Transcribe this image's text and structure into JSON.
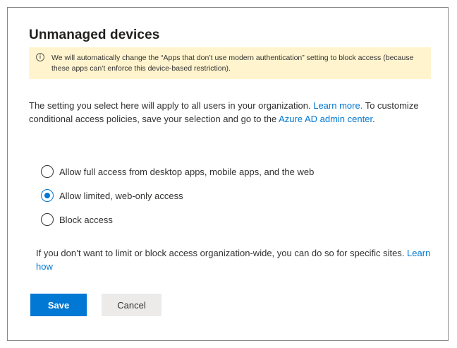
{
  "panel": {
    "title": "Unmanaged devices",
    "warning": {
      "icon": "info-icon",
      "text": "We will automatically change the “Apps that don’t use modern authentication” setting to block access (because these apps can’t enforce this device-based restriction)."
    },
    "description": {
      "part1": "The setting you select here will apply to all users in your organization. ",
      "link1": "Learn more.",
      "part2": " To customize conditional access policies, save your selection and go to the ",
      "link2": "Azure AD admin center",
      "part3": "."
    },
    "options": [
      {
        "label": "Allow full access from desktop apps, mobile apps, and the web",
        "selected": false
      },
      {
        "label": "Allow limited, web-only access",
        "selected": true
      },
      {
        "label": "Block access",
        "selected": false
      }
    ],
    "note": {
      "text": "If you don’t want to limit or block access organization-wide, you can do so for specific sites. ",
      "link": "Learn how"
    },
    "buttons": {
      "save": "Save",
      "cancel": "Cancel"
    }
  },
  "colors": {
    "accent": "#0078d4",
    "warning_background": "#fff4ce",
    "border": "#8a8886"
  }
}
